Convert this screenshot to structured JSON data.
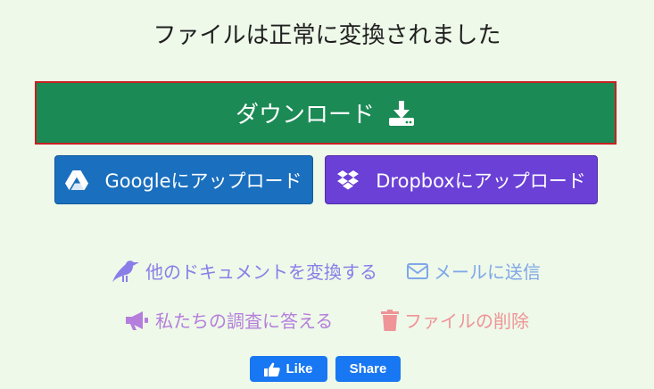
{
  "title": "ファイルは正常に変換されました",
  "download": {
    "label": "ダウンロード",
    "icon": "download-icon",
    "color": "#1b8a55",
    "border_color": "#c8201f"
  },
  "upload": {
    "google": {
      "label": "Googleにアップロード",
      "icon": "google-drive-icon",
      "color": "#1a6fbe"
    },
    "dropbox": {
      "label": "Dropboxにアップロード",
      "icon": "dropbox-icon",
      "color": "#6a40d6"
    }
  },
  "links": {
    "convert_other": {
      "label": "他のドキュメントを変換する",
      "icon": "bird-icon",
      "color": "#8a7de8"
    },
    "email": {
      "label": "メールに送信",
      "icon": "envelope-icon",
      "color": "#7fa7e8"
    },
    "survey": {
      "label": "私たちの調査に答える",
      "icon": "megaphone-icon",
      "color": "#b57edc"
    },
    "delete": {
      "label": "ファイルの削除",
      "icon": "trash-icon",
      "color": "#ef9497"
    }
  },
  "social": {
    "like_label": "Like",
    "share_label": "Share",
    "color": "#1877f2"
  }
}
